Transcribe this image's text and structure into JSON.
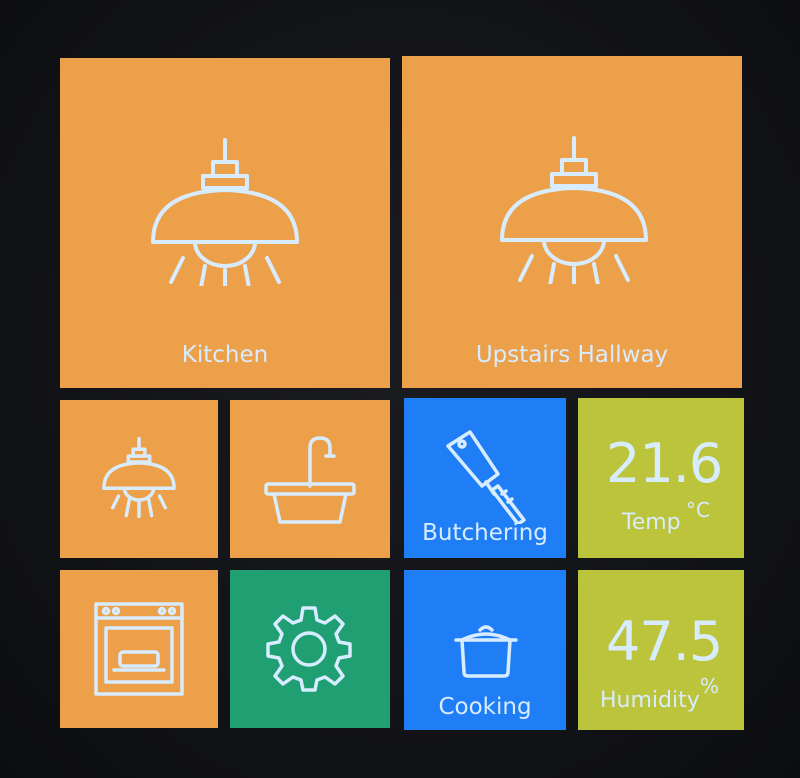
{
  "colors": {
    "orange": "#ecA04a",
    "blue": "#1f7df5",
    "green": "#1f9f72",
    "lime": "#bcc43c",
    "text": "#d8ecff"
  },
  "tiles": {
    "kitchen": {
      "label": "Kitchen",
      "icon": "pendant-lamp-icon"
    },
    "upstairs_hallway": {
      "label": "Upstairs Hallway",
      "icon": "pendant-lamp-icon"
    },
    "small_lamp": {
      "icon": "pendant-lamp-icon"
    },
    "sink": {
      "icon": "sink-faucet-icon"
    },
    "butchering": {
      "label": "Butchering",
      "icon": "cleaver-icon"
    },
    "temperature": {
      "value": "21.6",
      "label": "Temp",
      "unit": "°C"
    },
    "oven": {
      "icon": "oven-icon"
    },
    "settings": {
      "icon": "gear-icon"
    },
    "cooking": {
      "label": "Cooking",
      "icon": "cooking-pot-icon"
    },
    "humidity": {
      "value": "47.5",
      "label": "Humidity",
      "unit": "%"
    }
  }
}
